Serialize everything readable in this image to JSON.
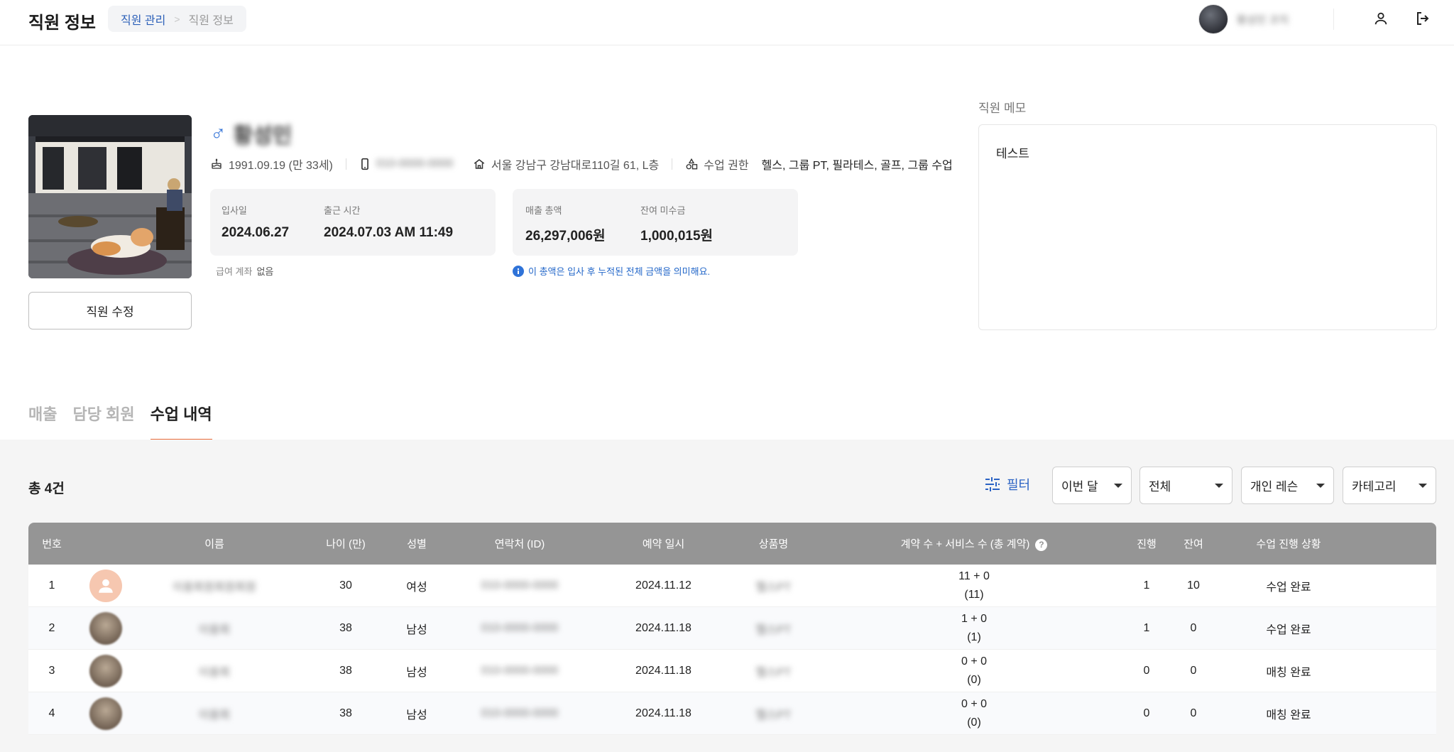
{
  "header": {
    "title": "직원 정보",
    "breadcrumb": {
      "parent": "직원 관리",
      "separator": ">",
      "current": "직원 정보"
    },
    "user": {
      "name": "황성민 코치"
    }
  },
  "profile": {
    "name": "황성민",
    "gender_symbol": "♂",
    "birth": "1991.09.19 (만 33세)",
    "phone": "010-0000-0000",
    "address": "서울 강남구 강남대로110길 61, L층",
    "class_permission_label": "수업 권한",
    "class_permission_value": "헬스, 그룹 PT, 필라테스, 골프, 그룹 수업",
    "edit_button": "직원 수정",
    "stats_left": [
      {
        "label": "입사일",
        "value": "2024.06.27"
      },
      {
        "label": "출근 시간",
        "value": "2024.07.03 AM 11:49"
      }
    ],
    "stats_right": [
      {
        "label": "매출 총액",
        "value": "26,297,006원"
      },
      {
        "label": "잔여 미수금",
        "value": "1,000,015원"
      }
    ],
    "account_label": "급여 계좌",
    "account_value": "없음",
    "notice": "이 총액은 입사 후 누적된 전체 금액을 의미해요."
  },
  "memo": {
    "label": "직원 메모",
    "content": "테스트"
  },
  "tabs": [
    {
      "label": "매출",
      "active": false
    },
    {
      "label": "담당 회원",
      "active": false
    },
    {
      "label": "수업 내역",
      "active": true
    }
  ],
  "list": {
    "total": "총 4건",
    "filter_label": "필터",
    "selects": [
      "이번 달",
      "전체",
      "개인 레슨",
      "카테고리"
    ],
    "columns": [
      "번호",
      "이름",
      "나이 (만)",
      "성별",
      "연락처 (ID)",
      "예약 일시",
      "상품명",
      "계약 수 + 서비스 수 (총 계약)",
      "진행",
      "잔여",
      "수업 진행 상황"
    ],
    "help_icon": "?",
    "rows": [
      {
        "no": "1",
        "name": "이용회원회원회원",
        "age": "30",
        "sex": "여성",
        "phone": "010-0000-0000",
        "date": "2024.11.12",
        "product": "헬스PT",
        "contract": "11 + 0",
        "total": "(11)",
        "progress": "1",
        "remain": "10",
        "status": "수업 완료"
      },
      {
        "no": "2",
        "name": "이용회",
        "age": "38",
        "sex": "남성",
        "phone": "010-0000-0000",
        "date": "2024.11.18",
        "product": "헬스PT",
        "contract": "1 + 0",
        "total": "(1)",
        "progress": "1",
        "remain": "0",
        "status": "수업 완료"
      },
      {
        "no": "3",
        "name": "이용회",
        "age": "38",
        "sex": "남성",
        "phone": "010-0000-0000",
        "date": "2024.11.18",
        "product": "헬스PT",
        "contract": "0 + 0",
        "total": "(0)",
        "progress": "0",
        "remain": "0",
        "status": "매칭 완료"
      },
      {
        "no": "4",
        "name": "이용회",
        "age": "38",
        "sex": "남성",
        "phone": "010-0000-0000",
        "date": "2024.11.18",
        "product": "헬스PT",
        "contract": "0 + 0",
        "total": "(0)",
        "progress": "0",
        "remain": "0",
        "status": "매칭 완료"
      }
    ]
  },
  "colors": {
    "accent": "#e96b3a",
    "link": "#2b63c4",
    "table_header": "#959595",
    "notice": "#2367c9"
  }
}
